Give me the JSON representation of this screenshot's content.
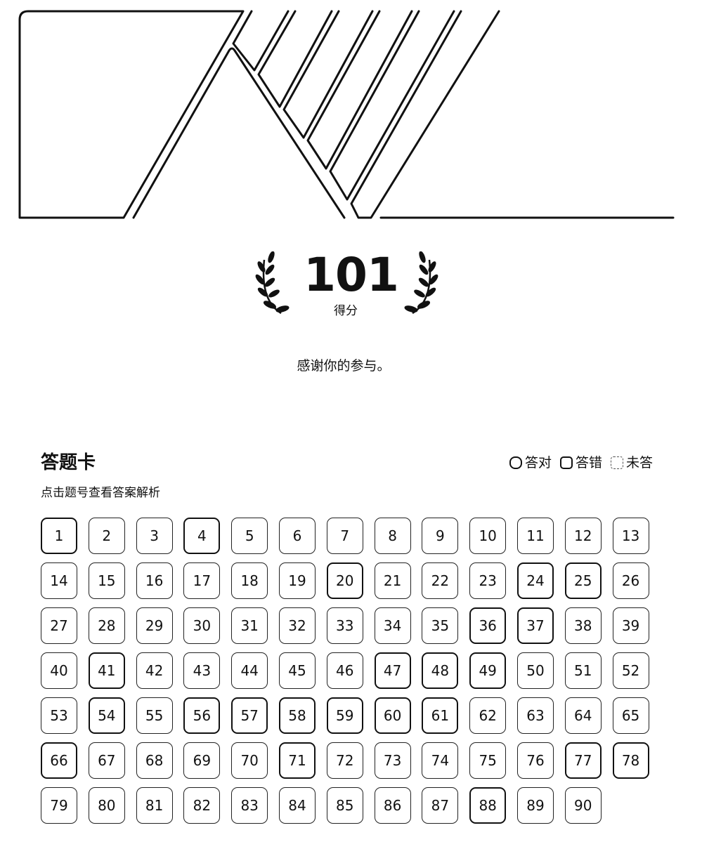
{
  "score": {
    "value": "101",
    "label": "得分"
  },
  "thanks_message": "感谢你的参与。",
  "answer_card": {
    "title": "答题卡",
    "hint": "点击题号查看答案解析",
    "legend": {
      "correct": "答对",
      "wrong": "答错",
      "unanswered": "未答"
    },
    "questions": [
      {
        "n": "1",
        "status": "wrong"
      },
      {
        "n": "2",
        "status": "correct"
      },
      {
        "n": "3",
        "status": "correct"
      },
      {
        "n": "4",
        "status": "wrong"
      },
      {
        "n": "5",
        "status": "correct"
      },
      {
        "n": "6",
        "status": "correct"
      },
      {
        "n": "7",
        "status": "correct"
      },
      {
        "n": "8",
        "status": "correct"
      },
      {
        "n": "9",
        "status": "correct"
      },
      {
        "n": "10",
        "status": "correct"
      },
      {
        "n": "11",
        "status": "correct"
      },
      {
        "n": "12",
        "status": "correct"
      },
      {
        "n": "13",
        "status": "correct"
      },
      {
        "n": "14",
        "status": "correct"
      },
      {
        "n": "15",
        "status": "correct"
      },
      {
        "n": "16",
        "status": "correct"
      },
      {
        "n": "17",
        "status": "correct"
      },
      {
        "n": "18",
        "status": "correct"
      },
      {
        "n": "19",
        "status": "correct"
      },
      {
        "n": "20",
        "status": "wrong"
      },
      {
        "n": "21",
        "status": "correct"
      },
      {
        "n": "22",
        "status": "correct"
      },
      {
        "n": "23",
        "status": "correct"
      },
      {
        "n": "24",
        "status": "wrong"
      },
      {
        "n": "25",
        "status": "wrong"
      },
      {
        "n": "26",
        "status": "correct"
      },
      {
        "n": "27",
        "status": "correct"
      },
      {
        "n": "28",
        "status": "correct"
      },
      {
        "n": "29",
        "status": "correct"
      },
      {
        "n": "30",
        "status": "correct"
      },
      {
        "n": "31",
        "status": "correct"
      },
      {
        "n": "32",
        "status": "correct"
      },
      {
        "n": "33",
        "status": "correct"
      },
      {
        "n": "34",
        "status": "correct"
      },
      {
        "n": "35",
        "status": "correct"
      },
      {
        "n": "36",
        "status": "wrong"
      },
      {
        "n": "37",
        "status": "wrong"
      },
      {
        "n": "38",
        "status": "correct"
      },
      {
        "n": "39",
        "status": "correct"
      },
      {
        "n": "40",
        "status": "correct"
      },
      {
        "n": "41",
        "status": "wrong"
      },
      {
        "n": "42",
        "status": "correct"
      },
      {
        "n": "43",
        "status": "correct"
      },
      {
        "n": "44",
        "status": "correct"
      },
      {
        "n": "45",
        "status": "correct"
      },
      {
        "n": "46",
        "status": "correct"
      },
      {
        "n": "47",
        "status": "wrong"
      },
      {
        "n": "48",
        "status": "wrong"
      },
      {
        "n": "49",
        "status": "wrong"
      },
      {
        "n": "50",
        "status": "correct"
      },
      {
        "n": "51",
        "status": "correct"
      },
      {
        "n": "52",
        "status": "correct"
      },
      {
        "n": "53",
        "status": "correct"
      },
      {
        "n": "54",
        "status": "wrong"
      },
      {
        "n": "55",
        "status": "correct"
      },
      {
        "n": "56",
        "status": "wrong"
      },
      {
        "n": "57",
        "status": "wrong"
      },
      {
        "n": "58",
        "status": "wrong"
      },
      {
        "n": "59",
        "status": "wrong"
      },
      {
        "n": "60",
        "status": "wrong"
      },
      {
        "n": "61",
        "status": "wrong"
      },
      {
        "n": "62",
        "status": "correct"
      },
      {
        "n": "63",
        "status": "correct"
      },
      {
        "n": "64",
        "status": "correct"
      },
      {
        "n": "65",
        "status": "correct"
      },
      {
        "n": "66",
        "status": "wrong"
      },
      {
        "n": "67",
        "status": "correct"
      },
      {
        "n": "68",
        "status": "correct"
      },
      {
        "n": "69",
        "status": "correct"
      },
      {
        "n": "70",
        "status": "correct"
      },
      {
        "n": "71",
        "status": "wrong"
      },
      {
        "n": "72",
        "status": "correct"
      },
      {
        "n": "73",
        "status": "correct"
      },
      {
        "n": "74",
        "status": "correct"
      },
      {
        "n": "75",
        "status": "correct"
      },
      {
        "n": "76",
        "status": "correct"
      },
      {
        "n": "77",
        "status": "wrong"
      },
      {
        "n": "78",
        "status": "wrong"
      },
      {
        "n": "79",
        "status": "correct"
      },
      {
        "n": "80",
        "status": "correct"
      },
      {
        "n": "81",
        "status": "correct"
      },
      {
        "n": "82",
        "status": "correct"
      },
      {
        "n": "83",
        "status": "correct"
      },
      {
        "n": "84",
        "status": "correct"
      },
      {
        "n": "85",
        "status": "correct"
      },
      {
        "n": "86",
        "status": "correct"
      },
      {
        "n": "87",
        "status": "correct"
      },
      {
        "n": "88",
        "status": "wrong"
      },
      {
        "n": "89",
        "status": "correct"
      },
      {
        "n": "90",
        "status": "correct"
      }
    ]
  }
}
